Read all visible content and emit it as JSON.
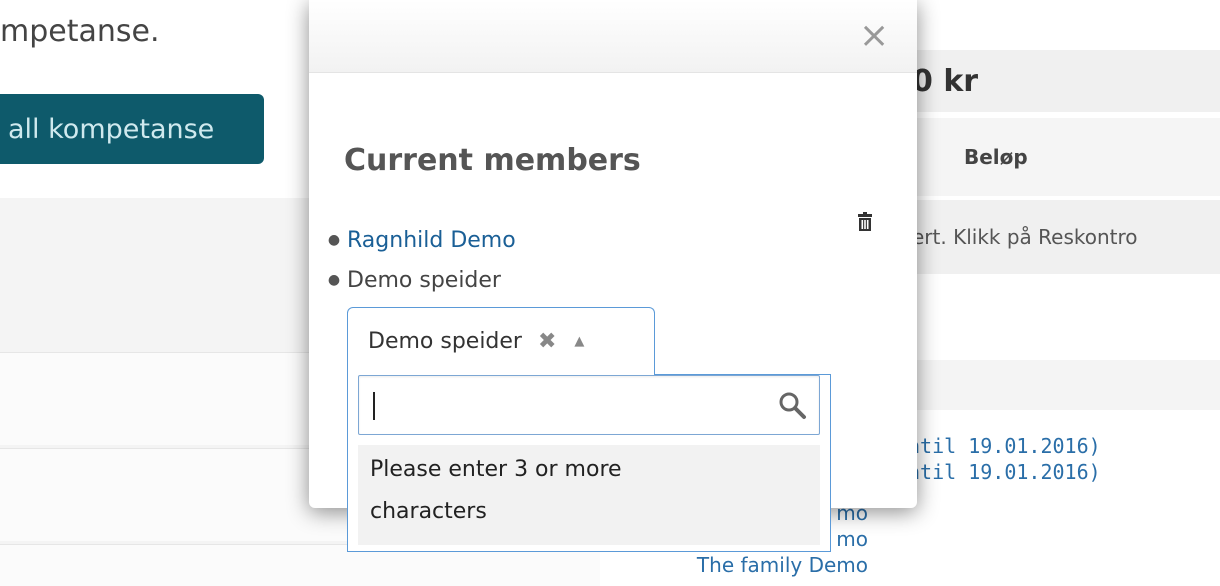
{
  "background": {
    "heading_fragment": "mpetanse.",
    "button_label": "all kompetanse",
    "right_header": "0 kr",
    "right_column": "Beløp",
    "right_note": "ert. Klikk på Reskontro",
    "dates": [
      "ntil 19.01.2016)",
      "ntil 19.01.2016)"
    ],
    "family_lines": [
      "mo",
      "mo",
      "The family Demo"
    ]
  },
  "modal": {
    "title": "Current members",
    "members": [
      {
        "name": "Ragnhild Demo",
        "linked": true
      },
      {
        "name": "Demo speider",
        "linked": false
      }
    ]
  },
  "select": {
    "selected_value": "Demo speider",
    "clear_symbol": "✖",
    "arrow_symbol": "▲",
    "search_value": "",
    "message_line1": "Please enter 3 or more",
    "message_line2": "characters"
  }
}
